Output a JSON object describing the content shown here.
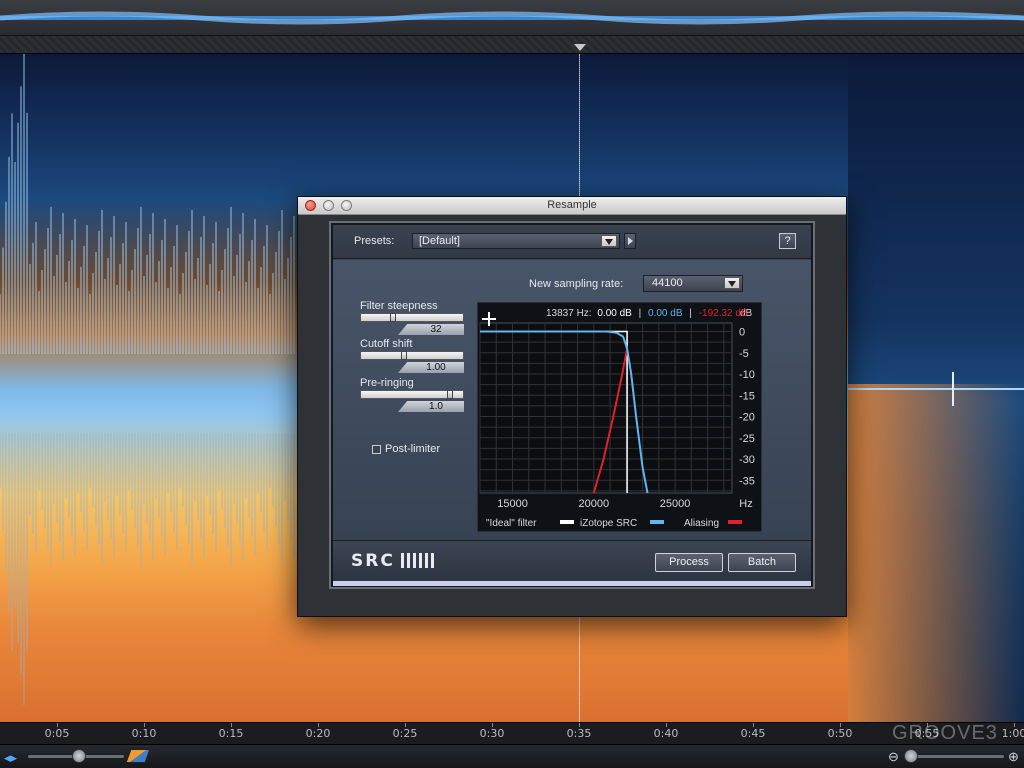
{
  "background": {
    "timeline_ticks": [
      "0:05",
      "0:10",
      "0:15",
      "0:20",
      "0:25",
      "0:30",
      "0:35",
      "0:40",
      "0:45",
      "0:50",
      "0:55",
      "1:00"
    ],
    "watermark": "GROOVE3",
    "icons": {
      "waveform": "waveform-icon",
      "color_mode": "spectrogram-color-icon",
      "zoom_out": "zoom-out-icon",
      "zoom_in": "zoom-in-icon"
    }
  },
  "dialog": {
    "title": "Resample",
    "presets": {
      "label": "Presets:",
      "value": "[Default]"
    },
    "help_label": "?",
    "sampling_rate": {
      "label": "New sampling rate:",
      "value": "44100"
    },
    "params": [
      {
        "label": "Filter steepness",
        "value": "32",
        "position": 0.3
      },
      {
        "label": "Cutoff shift",
        "value": "1.00",
        "position": 0.42
      },
      {
        "label": "Pre-ringing",
        "value": "1.0",
        "position": 0.9
      }
    ],
    "post_limiter": {
      "label": "Post-limiter",
      "checked": false
    },
    "readout": {
      "freq": "13837 Hz:",
      "ideal": "0.00 dB",
      "sep1": "|",
      "src": "0.00 dB",
      "sep2": "|",
      "alias": "-192.32 dB"
    },
    "logo": "SRC",
    "buttons": {
      "process": "Process",
      "batch": "Batch"
    }
  },
  "chart_data": {
    "type": "line",
    "xlabel": "Hz",
    "ylabel": "dB",
    "x_ticks": [
      15000,
      20000,
      25000
    ],
    "x_tick_labels": [
      "15000",
      "20000",
      "25000"
    ],
    "y_ticks": [
      0,
      -5,
      -10,
      -15,
      -20,
      -25,
      -30,
      -35
    ],
    "y_tick_labels": [
      "0",
      "-5",
      "-10",
      "-15",
      "-20",
      "-25",
      "-30",
      "-35"
    ],
    "xlim": [
      13000,
      28500
    ],
    "ylim": [
      -38,
      2
    ],
    "grid": true,
    "legend_placement": "bottom",
    "series": [
      {
        "name": "\"Ideal\" filter",
        "color": "#ffffff",
        "x": [
          13000,
          22050,
          22050
        ],
        "y": [
          0,
          0,
          -38
        ]
      },
      {
        "name": "iZotope SRC",
        "color": "#5fb6f0",
        "x": [
          13000,
          20800,
          21400,
          21800,
          22050,
          22300,
          22600,
          23000,
          23300
        ],
        "y": [
          0,
          0,
          -0.3,
          -1.2,
          -4,
          -10,
          -20,
          -32,
          -38
        ]
      },
      {
        "name": "Aliasing",
        "color": "#e0212b",
        "x": [
          20000,
          20600,
          21200,
          21700,
          22050
        ],
        "y": [
          -38,
          -30,
          -20,
          -11,
          -4
        ]
      }
    ]
  }
}
